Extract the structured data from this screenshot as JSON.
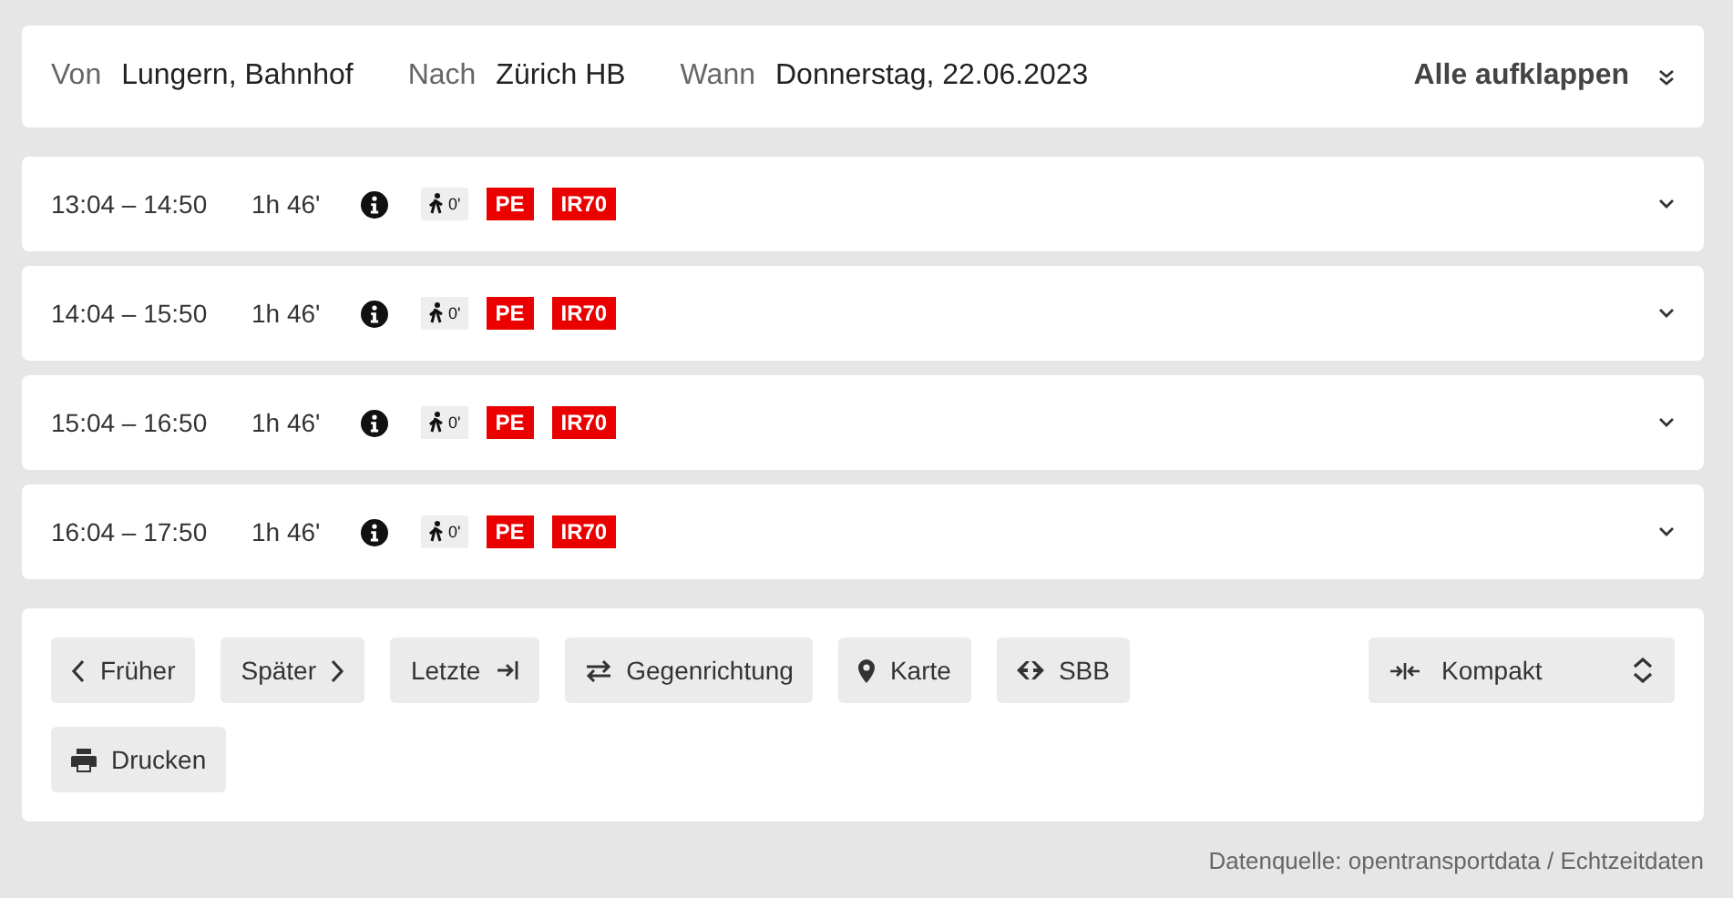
{
  "search": {
    "from_label": "Von",
    "from": "Lungern, Bahnhof",
    "to_label": "Nach",
    "to": "Zürich HB",
    "when_label": "Wann",
    "when": "Donnerstag, 22.06.2023",
    "expand_all": "Alle aufklappen"
  },
  "connections": [
    {
      "time": "13:04 – 14:50",
      "duration": "1h 46'",
      "walk": "0'",
      "products": [
        "PE",
        "IR70"
      ],
      "expanded": false
    },
    {
      "time": "14:04 – 15:50",
      "duration": "1h 46'",
      "walk": "0'",
      "products": [
        "PE",
        "IR70"
      ],
      "expanded": false
    },
    {
      "time": "15:04 – 16:50",
      "duration": "1h 46'",
      "walk": "0'",
      "products": [
        "PE",
        "IR70"
      ],
      "expanded": false
    },
    {
      "time": "16:04 – 17:50",
      "duration": "1h 46'",
      "walk": "0'",
      "products": [
        "PE",
        "IR70"
      ],
      "expanded": false
    }
  ],
  "actions": [
    {
      "label": "Früher",
      "kind": "earlier"
    },
    {
      "label": "Später",
      "kind": "later"
    },
    {
      "label": "Letzte",
      "kind": "last"
    },
    {
      "label": "Gegenrichtung",
      "kind": "reverse"
    },
    {
      "label": "Karte",
      "kind": "map"
    },
    {
      "label": "SBB",
      "kind": "sbb"
    },
    {
      "label": "Drucken",
      "kind": "print"
    }
  ],
  "view_select": {
    "value": "Kompakt"
  },
  "footer": "Datenquelle: opentransportdata / Echtzeitdaten"
}
